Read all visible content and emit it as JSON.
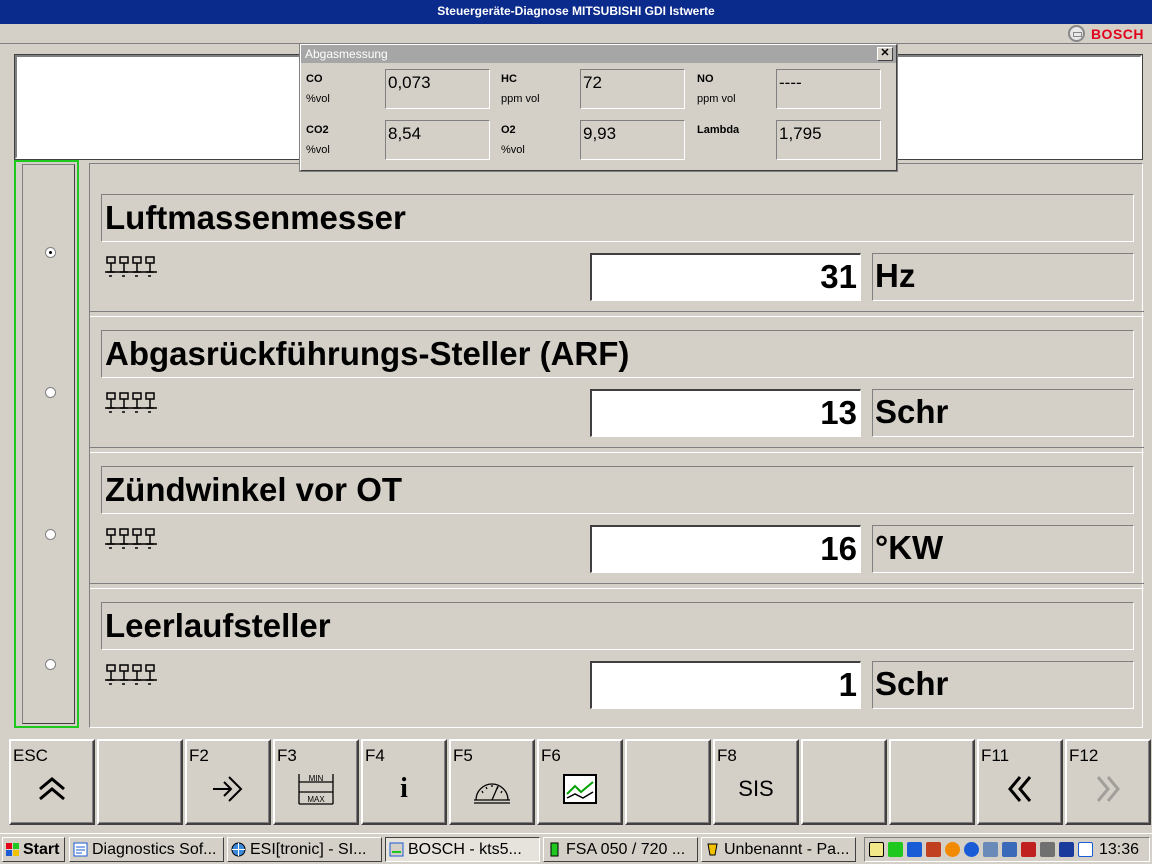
{
  "window": {
    "title": "Steuergeräte-Diagnose  MITSUBISHI  GDI  Istwerte"
  },
  "brand": {
    "name": "BOSCH",
    "color": "#e2001a"
  },
  "accent_colors": {
    "titlebar": "#0a2a8c",
    "selection_border": "#1ec81e"
  },
  "abgasmessung": {
    "title": "Abgasmessung",
    "close_icon": "close-icon",
    "rows": [
      [
        {
          "name": "CO",
          "unit": "%vol",
          "value": "0,073"
        },
        {
          "name": "HC",
          "unit": "ppm vol",
          "value": "72"
        },
        {
          "name": "NO",
          "unit": "ppm vol",
          "value": "----"
        }
      ],
      [
        {
          "name": "CO2",
          "unit": "%vol",
          "value": "8,54"
        },
        {
          "name": "O2",
          "unit": "%vol",
          "value": "9,93"
        },
        {
          "name": "Lambda",
          "unit": "",
          "value": "1,795"
        }
      ]
    ]
  },
  "sections": [
    {
      "title": "Luftmassenmesser",
      "value": "31",
      "unit": "Hz",
      "selected": true,
      "icon": "engine-icon"
    },
    {
      "title": "Abgasrückführungs-Steller (ARF)",
      "value": "13",
      "unit": "Schr",
      "selected": false,
      "icon": "engine-icon"
    },
    {
      "title": "Zündwinkel vor OT",
      "value": "16",
      "unit": "°KW",
      "selected": false,
      "icon": "engine-icon"
    },
    {
      "title": "Leerlaufsteller",
      "value": "1",
      "unit": "Schr",
      "selected": false,
      "icon": "engine-icon"
    }
  ],
  "function_keys": [
    {
      "key": "ESC",
      "icon": "double-chevron-up-icon",
      "text": ""
    },
    {
      "key": "",
      "icon": "",
      "text": ""
    },
    {
      "key": "F2",
      "icon": "enter-arrow-icon",
      "text": ""
    },
    {
      "key": "F3",
      "icon": "min-max-icon",
      "text": "",
      "min": "MIN",
      "max": "MAX"
    },
    {
      "key": "F4",
      "icon": "info-icon",
      "text": "i"
    },
    {
      "key": "F5",
      "icon": "gauge-icon",
      "text": ""
    },
    {
      "key": "F6",
      "icon": "graph-icon",
      "text": ""
    },
    {
      "key": "",
      "icon": "",
      "text": ""
    },
    {
      "key": "F8",
      "icon": "",
      "text": "SIS"
    },
    {
      "key": "",
      "icon": "",
      "text": ""
    },
    {
      "key": "",
      "icon": "",
      "text": ""
    },
    {
      "key": "F11",
      "icon": "double-chevron-left-icon",
      "text": ""
    },
    {
      "key": "F12",
      "icon": "double-chevron-right-icon",
      "text": "",
      "disabled": true
    }
  ],
  "taskbar": {
    "start_label": "Start",
    "tasks": [
      {
        "label": "Diagnostics Sof...",
        "icon": "app-icon",
        "active": false
      },
      {
        "label": "ESI[tronic] - SI...",
        "icon": "globe-icon",
        "active": false
      },
      {
        "label": "BOSCH - kts5...",
        "icon": "bosch-app-icon",
        "active": true
      },
      {
        "label": "FSA 050 / 720 ...",
        "icon": "device-icon",
        "active": false
      },
      {
        "label": "Unbenannt - Pa...",
        "icon": "paint-icon",
        "active": false
      }
    ],
    "clock": "13:36"
  }
}
